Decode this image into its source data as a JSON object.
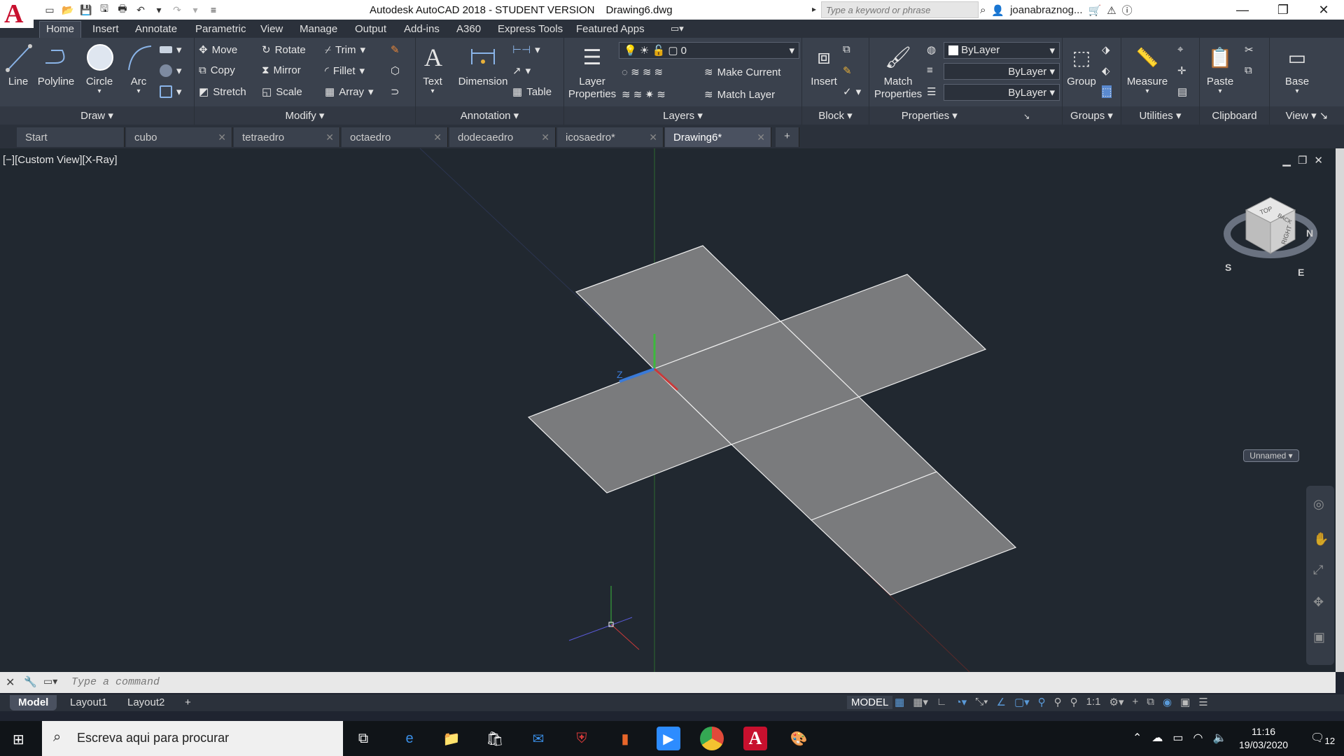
{
  "window": {
    "title": "Autodesk AutoCAD 2018 - STUDENT VERSION",
    "filename": "Drawing6.dwg",
    "search_placeholder": "Type a keyword or phrase",
    "user": "joanabraznog..."
  },
  "menu_tabs": [
    "Home",
    "Insert",
    "Annotate",
    "Parametric",
    "View",
    "Manage",
    "Output",
    "Add-ins",
    "A360",
    "Express Tools",
    "Featured Apps"
  ],
  "ribbon": {
    "draw": {
      "line": "Line",
      "polyline": "Polyline",
      "circle": "Circle",
      "arc": "Arc",
      "label": "Draw"
    },
    "modify": {
      "move": "Move",
      "rotate": "Rotate",
      "trim": "Trim",
      "copy": "Copy",
      "mirror": "Mirror",
      "fillet": "Fillet",
      "stretch": "Stretch",
      "scale": "Scale",
      "array": "Array",
      "label": "Modify"
    },
    "annotation": {
      "text": "Text",
      "dimension": "Dimension",
      "table": "Table",
      "label": "Annotation"
    },
    "layers": {
      "layer_properties": "Layer Properties",
      "current_layer": "0",
      "make_current": "Make Current",
      "match_layer": "Match Layer",
      "label": "Layers"
    },
    "block": {
      "insert": "Insert",
      "label": "Block"
    },
    "properties": {
      "match_properties": "Match Properties",
      "color": "ByLayer",
      "linetype": "ByLayer",
      "lineweight": "ByLayer",
      "label": "Properties"
    },
    "groups": {
      "group": "Group",
      "label": "Groups"
    },
    "utilities": {
      "measure": "Measure",
      "label": "Utilities"
    },
    "clipboard": {
      "paste": "Paste",
      "label": "Clipboard"
    },
    "view": {
      "base": "Base",
      "label": "View"
    }
  },
  "file_tabs": [
    "Start",
    "cubo",
    "tetraedro",
    "octaedro",
    "dodecaedro",
    "icosaedro*",
    "Drawing6*"
  ],
  "viewport": {
    "label": "[−][Custom View][X-Ray]",
    "viewcube_name": "Unnamed",
    "viewcube_faces": [
      "TOP",
      "RIGHT",
      "BACK"
    ],
    "compass": [
      "N",
      "S",
      "E"
    ]
  },
  "command": {
    "placeholder": "Type a command"
  },
  "layout_tabs": [
    "Model",
    "Layout1",
    "Layout2"
  ],
  "status": {
    "model": "MODEL",
    "scale": "1:1"
  },
  "taskbar": {
    "search_placeholder": "Escreva aqui para procurar",
    "time": "11:16",
    "date": "19/03/2020",
    "notifications": "12"
  },
  "colors": {
    "accent": "#c8102e",
    "face": "#7a7b7d",
    "background": "#212830"
  }
}
